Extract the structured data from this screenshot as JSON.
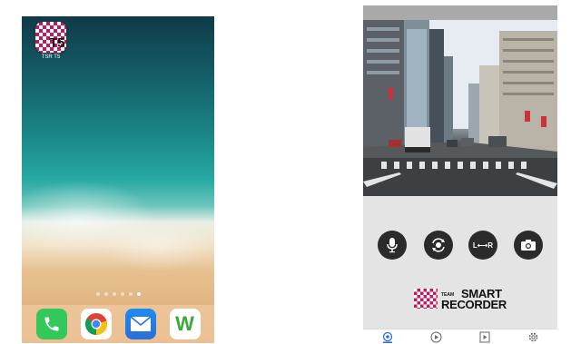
{
  "home_screen": {
    "app": {
      "name": "TSR T5",
      "icon_text": "T5",
      "icon": "checkered-flag-icon"
    },
    "page_dots": 6,
    "active_dot": 5,
    "dock": [
      {
        "name": "phone",
        "icon": "phone-icon",
        "color": "#34c759"
      },
      {
        "name": "chrome",
        "icon": "chrome-icon",
        "color": "#ffffff"
      },
      {
        "name": "mail",
        "icon": "mail-icon",
        "color": "#1e8cf0"
      },
      {
        "name": "w-app",
        "icon": "w-icon",
        "text": "W",
        "color": "#3aa83a"
      }
    ]
  },
  "recorder_app": {
    "controls": [
      {
        "name": "mic",
        "icon": "microphone-icon"
      },
      {
        "name": "rotate",
        "icon": "rotate-camera-icon"
      },
      {
        "name": "lr-swap",
        "icon": "lr-swap-icon",
        "text": "L⟷R"
      },
      {
        "name": "snapshot",
        "icon": "camera-icon"
      }
    ],
    "brand": {
      "prefix": "TEAM",
      "line1": "SMART",
      "line2": "RECORDER",
      "accent": "#c4175c"
    },
    "tabs": [
      {
        "name": "live",
        "icon": "live-camera-icon",
        "active": true
      },
      {
        "name": "playback",
        "icon": "play-circle-icon"
      },
      {
        "name": "videos",
        "icon": "video-file-icon"
      },
      {
        "name": "settings",
        "icon": "gear-icon"
      }
    ]
  }
}
